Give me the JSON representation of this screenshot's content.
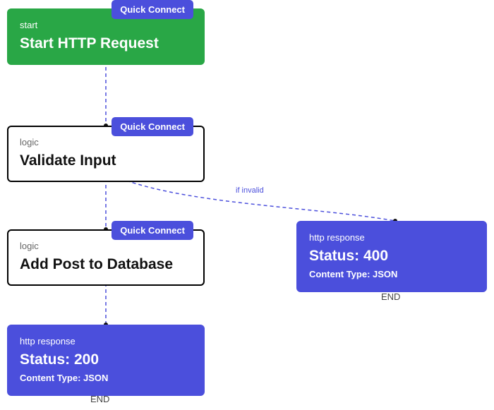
{
  "nodes": {
    "start": {
      "tag": "start",
      "title": "Start HTTP Request",
      "quick_connect": "Quick Connect"
    },
    "validate": {
      "tag": "logic",
      "title": "Validate Input",
      "quick_connect": "Quick Connect"
    },
    "addpost": {
      "tag": "logic",
      "title": "Add Post to Database",
      "quick_connect": "Quick Connect"
    },
    "resp200": {
      "tag": "http response",
      "title": "Status: 200",
      "subtitle": "Content Type: JSON"
    },
    "resp400": {
      "tag": "http response",
      "title": "Status: 400",
      "subtitle": "Content Type: JSON"
    }
  },
  "edges": {
    "invalid_label": "if invalid"
  },
  "end_labels": {
    "left": "END",
    "right": "END"
  },
  "colors": {
    "green": "#29a746",
    "purple": "#4b4fdc",
    "dash": "#4b4fdc"
  }
}
